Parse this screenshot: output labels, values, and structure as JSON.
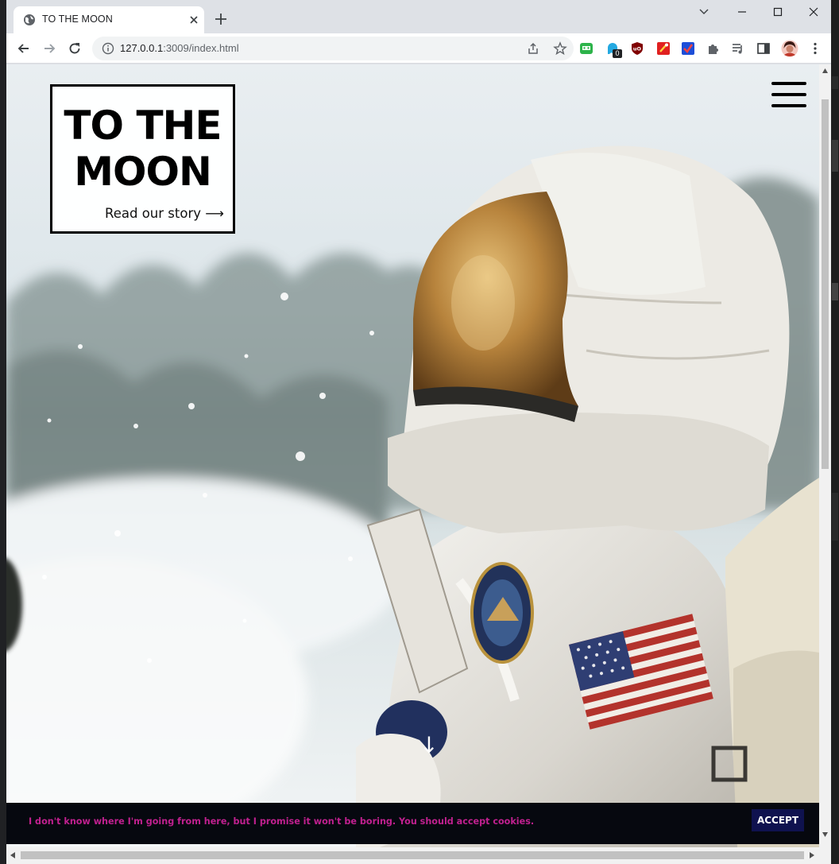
{
  "browser": {
    "tab_title": "TO THE MOON",
    "url_host": "127.0.0.1",
    "url_rest": ":3009/index.html",
    "extension_badge": "0"
  },
  "page": {
    "logo_title_line1": "TO THE",
    "logo_title_line2": "MOON",
    "read_story_link": "Read our story ⟶",
    "scroll_arrow": "↓",
    "cookie_message": "I don't know where I'm going from here, but I promise it won't be boring. You should accept cookies.",
    "accept_button": "ACCEPT"
  },
  "icons": {
    "tab_favicon": "globe-icon",
    "tab_close": "close-icon",
    "new_tab": "plus-icon",
    "back": "arrow-left-icon",
    "forward": "arrow-right-icon",
    "reload": "reload-icon",
    "site_info": "info-icon",
    "share": "share-icon",
    "bookmark": "star-icon",
    "menu": "hamburger-menu-icon"
  },
  "colors": {
    "cookie_text": "#c0208f",
    "cookie_bar": "#06080f",
    "accept_button": "#0f124f",
    "browser_frame": "#dee1e6"
  }
}
